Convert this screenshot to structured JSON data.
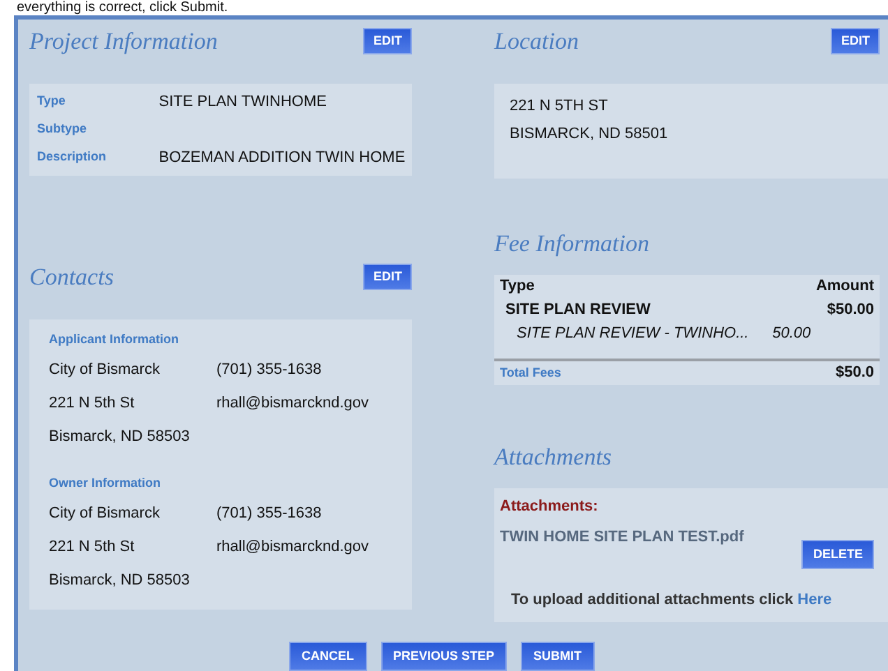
{
  "instruction": "everything is correct, click Submit.",
  "project": {
    "title": "Project Information",
    "edit": "EDIT",
    "fields": [
      {
        "label": "Type",
        "value": "SITE PLAN TWINHOME"
      },
      {
        "label": "Subtype"
      },
      {
        "label": "Description",
        "value": "BOZEMAN ADDITION TWIN HOME"
      }
    ]
  },
  "location": {
    "title": "Location",
    "edit": "EDIT",
    "lines": [
      "221 N 5TH ST",
      "BISMARCK, ND 58501"
    ]
  },
  "contacts": {
    "title": "Contacts",
    "edit": "EDIT",
    "groups": [
      {
        "heading": "Applicant Information",
        "rows": [
          [
            "City of Bismarck",
            "(701) 355-1638"
          ],
          [
            "221 N 5th St",
            "rhall@bismarcknd.gov"
          ],
          [
            "Bismarck, ND 58503"
          ]
        ]
      },
      {
        "heading": "Owner Information",
        "rows": [
          [
            "City of Bismarck",
            "(701) 355-1638"
          ],
          [
            "221 N 5th St",
            "rhall@bismarcknd.gov"
          ],
          [
            "Bismarck, ND 58503"
          ]
        ]
      }
    ]
  },
  "fees": {
    "title": "Fee Information",
    "columns": [
      "Type",
      "Amount"
    ],
    "items": [
      {
        "name": "SITE PLAN REVIEW",
        "amount": "$50.00",
        "sub": {
          "name": "SITE PLAN REVIEW - TWINHO...",
          "amount": "50.00"
        }
      }
    ],
    "total_label": "Total Fees",
    "total": "$50.0"
  },
  "attachments": {
    "title": "Attachments",
    "label": "Attachments:",
    "files": [
      {
        "name": "TWIN HOME SITE PLAN TEST.pdf",
        "action": "DELETE"
      }
    ],
    "upload_text": "To upload additional attachments click",
    "upload_link": "Here"
  },
  "buttons": [
    "CANCEL",
    "PREVIOUS STEP",
    "SUBMIT"
  ]
}
